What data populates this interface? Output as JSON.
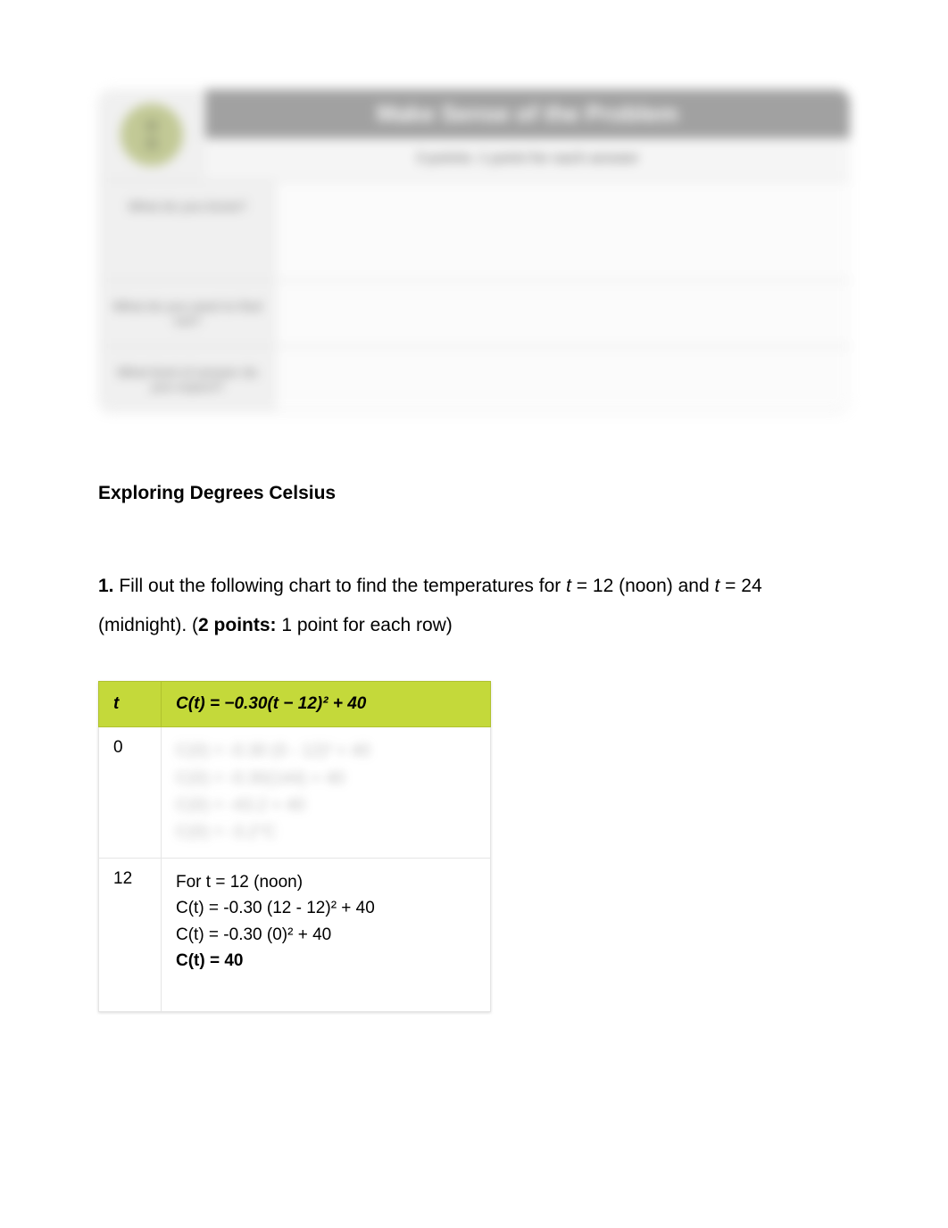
{
  "worksheet": {
    "title": "Make Sense of the Problem",
    "subtitle": "3 points: 1 point for each answer",
    "row1_label": "What do you know?",
    "row2_label": "What do you want to find out?",
    "row3_label": "What kind of answer do you expect?"
  },
  "section": {
    "title": "Exploring Degrees Celsius"
  },
  "question1": {
    "number": "1.",
    "text_a": " Fill out the following chart to find the temperatures for ",
    "t": "t",
    "text_b": " = 12 (noon) and ",
    "text_c": " = 24 (midnight). (",
    "points_label": "2 points:",
    "text_d": " 1 point for each row)"
  },
  "table": {
    "header_t": "t",
    "header_formula": "C(t) = −0.30(t − 12)² + 40",
    "rows": [
      {
        "t": "0",
        "work": [
          "C(0) = -0.30 (0 - 12)² + 40",
          "C(0) = -0.30(144) + 40",
          "C(0) = -43.2 + 40",
          "C(0) = -3.2°C"
        ]
      },
      {
        "t": "12",
        "work": [
          "For t = 12 (noon)",
          "C(t) = -0.30 (12 - 12)² + 40",
          "C(t) = -0.30 (0)² + 40"
        ],
        "result": "C(t) = 40"
      }
    ]
  }
}
